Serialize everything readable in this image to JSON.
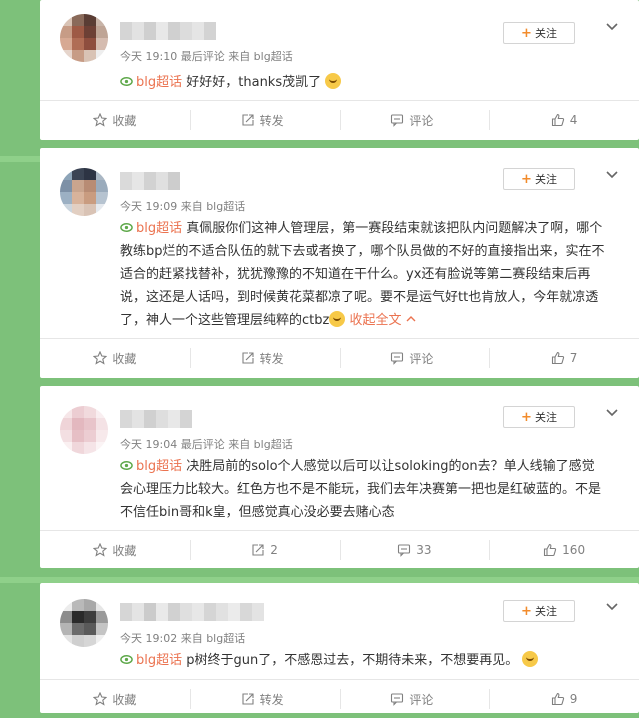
{
  "follow_label": "关注",
  "action_labels": {
    "favorite": "收藏",
    "repost": "转发",
    "comment": "评论"
  },
  "posts": [
    {
      "meta": "今天 19:10 最后评论 来自 blg超话",
      "tag": "blg超话",
      "text": "好好好，thanks茂凯了",
      "repost_count": "",
      "comment_count": "",
      "like_count": "4"
    },
    {
      "meta": "今天 19:09 来自 blg超话",
      "tag": "blg超话",
      "text": "真佩服你们这神人管理层，第一赛段结束就该把队内问题解决了啊，哪个教练bp烂的不适合队伍的就下去或者换了，哪个队员做的不好的直接指出来，实在不适合的赶紧找替补，犹犹豫豫的不知道在干什么。yx还有脸说等第二赛段结束后再说，这还是人话吗，到时候黄花菜都凉了呢。要不是运气好tt也肯放人，今年就凉透了，神人一个这些管理层纯粹的ctbz",
      "collapse_label": "收起全文",
      "repost_count": "",
      "comment_count": "",
      "like_count": "7"
    },
    {
      "meta": "今天 19:04 最后评论 来自 blg超话",
      "tag": "blg超话",
      "text": "决胜局前的solo个人感觉以后可以让soloking的on去？单人线输了感觉会心理压力比较大。红色方也不是不能玩，我们去年决赛第一把也是红破蓝的。不是不信任bin哥和k皇，但感觉真心没必要去赌心态",
      "repost_count": "2",
      "comment_count": "33",
      "like_count": "160"
    },
    {
      "meta": "今天 19:02 来自 blg超话",
      "tag": "blg超话",
      "text": "p树终于gun了，不感恩过去，不期待未来，不想要再见。",
      "repost_count": "",
      "comment_count": "",
      "like_count": "9"
    }
  ]
}
